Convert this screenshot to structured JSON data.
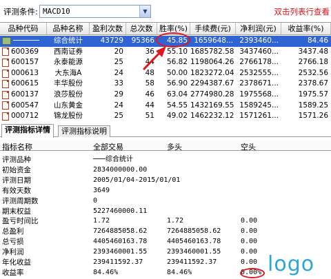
{
  "toolbar": {
    "condition_label": "评测条件:",
    "condition_value": "MACD10",
    "hint": "双击列表行查看"
  },
  "columns": [
    "品种代码",
    "品种名称",
    "盈利次数",
    "总次数",
    "胜率(%)",
    "手续费(元)",
    "净利润(元)",
    "收益率(%)"
  ],
  "rows": [
    {
      "code": "──────",
      "name": "综合统计",
      "win": "43729",
      "total": "95366",
      "rate": "45.85",
      "fee": "1659648...",
      "profit": "2393460...",
      "ret": "84.46",
      "type": "summary"
    },
    {
      "code": "600369",
      "name": "西南证券",
      "win": "20",
      "total": "36",
      "rate": "55.10",
      "fee": "1685782.58",
      "profit": "3437460...",
      "ret": "3437.48",
      "type": "doc"
    },
    {
      "code": "600157",
      "name": "永泰能源",
      "win": "25",
      "total": "44",
      "rate": "56.82",
      "fee": "1198064.26",
      "profit": "2766178...",
      "ret": "2766.18",
      "type": "doc"
    },
    {
      "code": "000613",
      "name": "大东海A",
      "win": "24",
      "total": "48",
      "rate": "50.00",
      "fee": "1823272.04",
      "profit": "2532555...",
      "ret": "2532.56",
      "type": "doc"
    },
    {
      "code": "600615",
      "name": "丰华股份",
      "win": "33",
      "total": "58",
      "rate": "56.90",
      "fee": "2294387.67",
      "profit": "2378671...",
      "ret": "2378.67",
      "type": "doc"
    },
    {
      "code": "600137",
      "name": "浪莎股份",
      "win": "29",
      "total": "46",
      "rate": "63.04",
      "fee": "2774980.28",
      "profit": "1975568...",
      "ret": "1975.57",
      "type": "doc"
    },
    {
      "code": "600547",
      "name": "山东黄金",
      "win": "24",
      "total": "44",
      "rate": "54.55",
      "fee": "1432169.55",
      "profit": "1589245...",
      "ret": "1589.25",
      "type": "doc"
    },
    {
      "code": "000712",
      "name": "锦龙股份",
      "win": "25",
      "total": "51",
      "rate": "49.02",
      "fee": "1462232.12",
      "profit": "1571261...",
      "ret": "1571.26",
      "type": "doc"
    }
  ],
  "tabs": [
    "评测指标详情",
    "评测指标说明"
  ],
  "detail": {
    "headers": [
      "指标名称",
      "全部交易",
      "多头",
      "空头"
    ],
    "rows": [
      {
        "label": "评测品种",
        "all": "───综合统计",
        "long": "",
        "short": ""
      },
      {
        "label": "初始资金",
        "all": "2834000000.00",
        "long": "",
        "short": ""
      },
      {
        "label": "评测日期",
        "all": "2005/01/04-2015/01/01",
        "long": "",
        "short": ""
      },
      {
        "label": "有效天数",
        "all": "3649",
        "long": "",
        "short": ""
      },
      {
        "label": "评测周期数",
        "all": "0",
        "long": "",
        "short": ""
      },
      {
        "label": "期末权益",
        "all": "5227460000.11",
        "long": "",
        "short": ""
      },
      {
        "label": "盈亏时间比",
        "all": "1.72",
        "long": "1.72",
        "short": "0.00"
      },
      {
        "label": "总盈利",
        "all": "7264885058.62",
        "long": "7264885058.62",
        "short": "0.00"
      },
      {
        "label": "总亏损",
        "all": "4405460163.78",
        "long": "4405460163.78",
        "short": "0.00"
      },
      {
        "label": "净利润",
        "all": "2393460001.55",
        "long": "2393460001.55",
        "short": "0.00"
      },
      {
        "label": "年化收益",
        "all": "239411592.37",
        "long": "239411592.37",
        "short": "0.00"
      },
      {
        "label": "收益率",
        "all": "84.46%",
        "long": "84.46%",
        "short": "0.00%"
      }
    ]
  },
  "logo": "logo"
}
